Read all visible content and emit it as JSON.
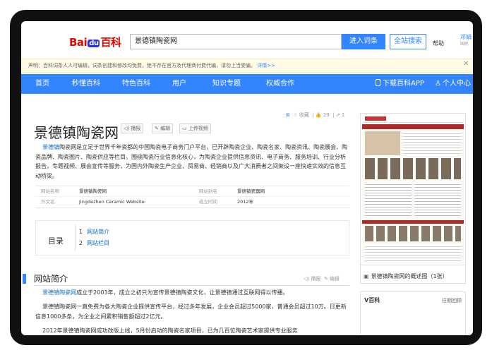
{
  "header": {
    "logo_text_a": "Bai",
    "logo_text_b": "du",
    "logo_text_c": "百科",
    "search_value": "景德镇陶瓷网",
    "enter_entry_label": "进入词条",
    "full_search_label": "全站搜索",
    "help_label": "帮助",
    "user_line1": "邓娟",
    "user_line2": "国民"
  },
  "notice": {
    "text": "声明：百科词条人人可编辑，词条创建和修改均免费，绝不存在官方及代理商付费代编，请勿上当受骗。",
    "link": "详情>>",
    "close": "✕"
  },
  "nav": {
    "items": [
      "首页",
      "秒懂百科",
      "特色百科",
      "用户",
      "知识专题",
      "权威合作"
    ],
    "download_app": "下载百科APP",
    "personal_center": "个人中心"
  },
  "entry": {
    "title": "景德镇陶瓷网",
    "play_label": "播报",
    "edit_label": "编辑",
    "upload_video_label": "上传视频",
    "collect_label": "收藏",
    "like_count": "29",
    "share_count": "1",
    "summary_kw": "景德镇",
    "summary_rest": "陶瓷网是立足于世界千年瓷都的中国陶瓷电子商务门户平台，已开辟陶瓷企业、陶瓷名家、陶瓷资讯、陶瓷展会、陶瓷品牌、陶瓷图片、陶瓷供应等栏目。围绕陶瓷行业信息化核心，为陶瓷企业提供信息资讯、电子商务、服务培训、行业分析报告，专题视频、展会宣传等服务，为国内外陶瓷生产企业、贸易商、经销商以及广大消费者之间架设一座快速实效的信息互动桥梁。"
  },
  "info_table": [
    {
      "k1": "网站名称",
      "v1": "景德镇陶瓷网",
      "k2": "网站别名",
      "v2": "景德镇瓷器网"
    },
    {
      "k1": "外文名",
      "v1": "Jingdezhen Ceramic Website",
      "k2": "成立时间",
      "v2": "2012年"
    }
  ],
  "toc": {
    "title": "目录",
    "items": [
      {
        "num": "1",
        "label": "网站简介"
      },
      {
        "num": "2",
        "label": "网站栏目"
      }
    ]
  },
  "section": {
    "title": "网站简介",
    "play_label": "播报",
    "edit_label": "编辑",
    "p1_kw": "景德镇陶瓷网",
    "p1_rest": "成立于2003年，成立之初只为宣传景德镇陶瓷文化，让景德镇通过互联网得以传播。",
    "p2": "景德镇陶瓷网一直免费为各大陶瓷企业提供宣传平台，经过多年发展，企业会员超过5000家，普通会员超过10万。日更新信息1000多条，为企业之间累积销售额超过2亿元。",
    "p3": "2012年景德镇陶瓷网成功改版上线，5月份启动的陶瓷名家项目，已为几百位陶瓷艺术家提供专业服务"
  },
  "right": {
    "caption": "景德镇陶瓷网的概述图（1张）",
    "v_label": "V百科",
    "past_label": "往期回顾"
  },
  "colors": {
    "accent": "#3385ff",
    "link": "#136ec2",
    "logo_red": "#e10601"
  }
}
